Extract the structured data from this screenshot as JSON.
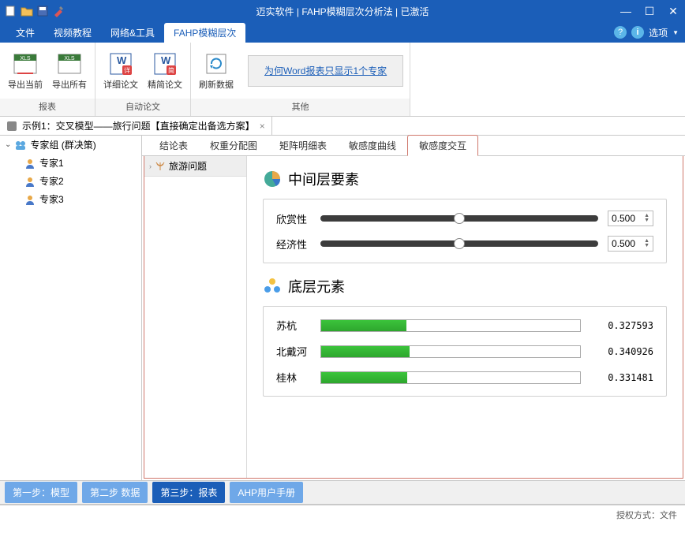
{
  "titlebar": {
    "title": "迈实软件 | FAHP模糊层次分析法 | 已激活"
  },
  "menu": {
    "file": "文件",
    "video": "视频教程",
    "network": "网络&工具",
    "fahp": "FAHP模糊层次"
  },
  "menuright": {
    "options": "选项"
  },
  "ribbon": {
    "export_current": "导出当前",
    "export_all": "导出所有",
    "detailed_thesis": "详细论文",
    "simple_thesis": "精简论文",
    "refresh_data": "刷新数据",
    "link": "为何Word报表只显示1个专家",
    "group_report": "报表",
    "group_auto": "自动论文",
    "group_other": "其他"
  },
  "doctab": {
    "title": "示例1：交叉模型——旅行问题【直接确定出备选方案】"
  },
  "tree": {
    "root": "专家组 (群决策)",
    "experts": [
      "专家1",
      "专家2",
      "专家3"
    ]
  },
  "result_tabs": {
    "conclusion": "结论表",
    "weight": "权重分配图",
    "matrix": "矩阵明细表",
    "curve": "敏感度曲线",
    "interaction": "敏感度交互"
  },
  "subtree": {
    "root": "旅游问题"
  },
  "mid_section": {
    "title": "中间层要素",
    "items": [
      {
        "label": "欣赏性",
        "value": "0.500",
        "pos": 50
      },
      {
        "label": "经济性",
        "value": "0.500",
        "pos": 50
      }
    ]
  },
  "bottom_section": {
    "title": "底层元素",
    "items": [
      {
        "label": "苏杭",
        "value": "0.327593",
        "pct": 32.8
      },
      {
        "label": "北戴河",
        "value": "0.340926",
        "pct": 34.1
      },
      {
        "label": "桂林",
        "value": "0.331481",
        "pct": 33.1
      }
    ]
  },
  "steps": {
    "s1": "第一步：模型",
    "s2": "第二步 数据",
    "s3": "第三步：报表",
    "manual": "AHP用户手册"
  },
  "status": {
    "auth": "授权方式：文件"
  },
  "chart_data": {
    "type": "bar",
    "title": "底层元素",
    "categories": [
      "苏杭",
      "北戴河",
      "桂林"
    ],
    "values": [
      0.327593,
      0.340926,
      0.331481
    ],
    "xlabel": "",
    "ylabel": "",
    "ylim": [
      0,
      1
    ]
  }
}
